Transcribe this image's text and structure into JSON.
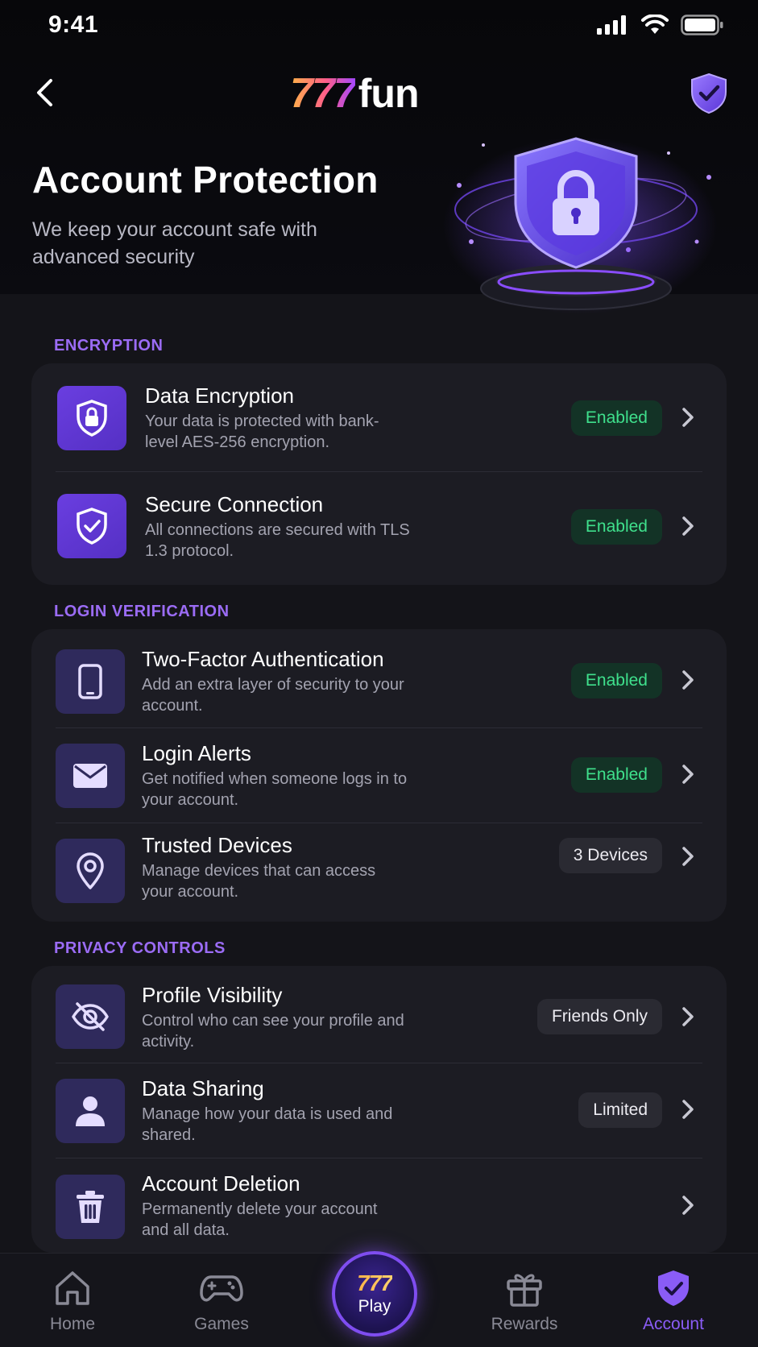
{
  "status_bar": {
    "time": "9:41"
  },
  "header": {
    "logo_number": "777",
    "logo_word": "fun"
  },
  "hero": {
    "title": "Account Protection",
    "subtitle": "We keep your account safe with advanced security"
  },
  "sections": {
    "encryption": {
      "label": "ENCRYPTION",
      "items": [
        {
          "title": "Data Encryption",
          "desc": "Your data is protected with bank-level AES-256 encryption.",
          "badge": "Enabled",
          "icon": "lock-shield-icon"
        },
        {
          "title": "Secure Connection",
          "desc": "All connections are secured with TLS 1.3 protocol.",
          "badge": "Enabled",
          "icon": "shield-check-icon"
        }
      ]
    },
    "login": {
      "label": "LOGIN VERIFICATION",
      "items": [
        {
          "title": "Two-Factor Authentication",
          "desc": "Add an extra layer of security to your account.",
          "badge": "Enabled",
          "icon": "phone-icon"
        },
        {
          "title": "Login Alerts",
          "desc": "Get notified when someone logs in to your account.",
          "badge": "Enabled",
          "icon": "envelope-icon"
        },
        {
          "title": "Trusted Devices",
          "desc": "Manage devices that can access your account.",
          "badge": "3 Devices",
          "icon": "location-pin-icon"
        }
      ]
    },
    "privacy": {
      "label": "PRIVACY CONTROLS",
      "items": [
        {
          "title": "Profile Visibility",
          "desc": "Control who can see your profile and activity.",
          "badge": "Friends Only",
          "icon": "eye-off-icon"
        },
        {
          "title": "Data Sharing",
          "desc": "Manage how your data is used and shared.",
          "badge": "Limited",
          "icon": "user-icon"
        },
        {
          "title": "Account Deletion",
          "desc": "Permanently delete your account and all data.",
          "icon": "trash-icon"
        }
      ]
    }
  },
  "nav": {
    "home": "Home",
    "games": "Games",
    "play_number": "777",
    "play": "Play",
    "rewards": "Rewards",
    "account": "Account"
  },
  "colors": {
    "accent": "#8a5cf6",
    "enabled_text": "#3fe08c",
    "background": "#0d0d12"
  }
}
